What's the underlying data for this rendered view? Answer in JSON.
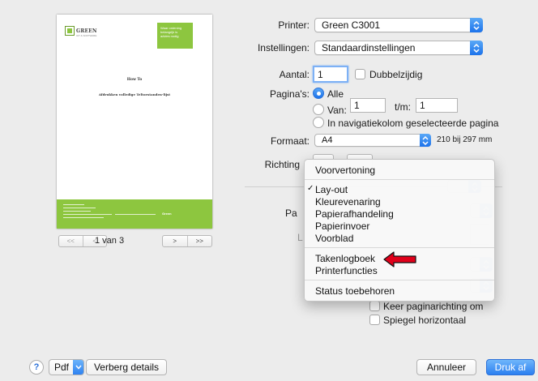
{
  "preview": {
    "logo_text": "GREEN",
    "logo_sub": "ICT & SOFTWARE",
    "tag_text": "Waar ordening\nbelangrijk is\nadvies nodig",
    "doc_title": "How To",
    "doc_subtitle": "Afdrukken volledige Teltoestanden-lijst",
    "footer_logo": "Green",
    "page_count": "1 van 3",
    "nav_first": "<<",
    "nav_prev": "<",
    "nav_next": ">",
    "nav_last": ">>"
  },
  "form": {
    "printer_label": "Printer:",
    "printer_value": "Green C3001",
    "settings_label": "Instellingen:",
    "settings_value": "Standaardinstellingen",
    "copies_label": "Aantal:",
    "copies_value": "1",
    "duplex_label": "Dubbelzijdig",
    "pages_label": "Pagina's:",
    "all_label": "Alle",
    "from_label": "Van:",
    "from_value": "1",
    "to_label": "t/m:",
    "to_value": "1",
    "sidebar_label": "In navigatiekolom geselecteerde pagina",
    "format_label": "Formaat:",
    "format_value": "A4",
    "format_size": "210 bij 297 mm",
    "orientation_label": "Richting",
    "hidden_label_pa": "Pa",
    "hidden_label_l": "L",
    "flip_label": "Keer paginarichting om",
    "mirror_label": "Spiegel horizontaal"
  },
  "menu": {
    "items": [
      "Voorvertoning",
      "Lay-out",
      "Kleurevenaring",
      "Papierafhandeling",
      "Papierinvoer",
      "Voorblad",
      "Takenlogboek",
      "Printerfuncties",
      "Status toebehoren"
    ],
    "checkmark": "✓"
  },
  "bottom": {
    "help": "?",
    "pdf": "Pdf",
    "hide_details": "Verberg details",
    "cancel": "Annuleer",
    "print": "Druk af"
  },
  "colors": {
    "accent": "#2b7ff0",
    "highlight_arrow": "#e0001a",
    "brand_green": "#8dc63f"
  },
  "icons": {
    "popup_arrows": "up-down-chevron-icon",
    "annotation": "red-arrow-icon"
  }
}
